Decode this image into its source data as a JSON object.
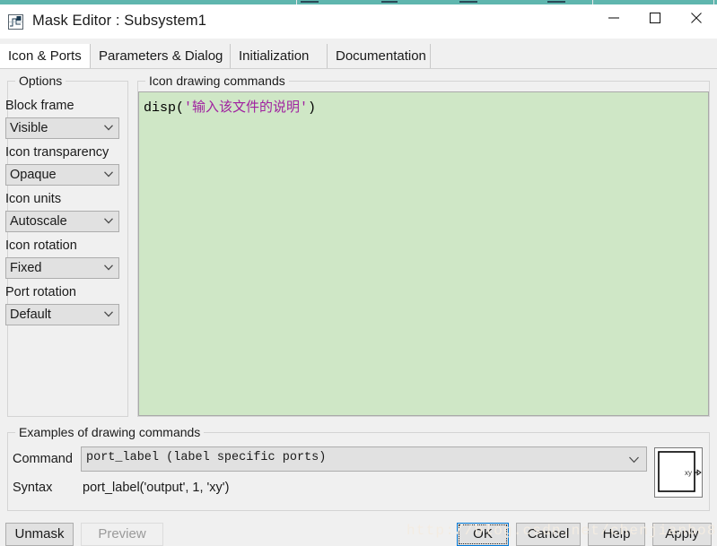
{
  "window": {
    "title": "Mask Editor : Subsystem1",
    "icon": "simulink-mask-icon",
    "controls": {
      "minimize": "minimize-icon",
      "maximize": "maximize-icon",
      "close": "close-icon"
    }
  },
  "tabs": [
    {
      "label": "Icon & Ports",
      "active": true
    },
    {
      "label": "Parameters & Dialog",
      "active": false
    },
    {
      "label": "Initialization",
      "active": false
    },
    {
      "label": "Documentation",
      "active": false
    }
  ],
  "options": {
    "group_title": "Options",
    "fields": [
      {
        "label": "Block frame",
        "value": "Visible"
      },
      {
        "label": "Icon transparency",
        "value": "Opaque"
      },
      {
        "label": "Icon units",
        "value": "Autoscale"
      },
      {
        "label": "Icon rotation",
        "value": "Fixed"
      },
      {
        "label": "Port rotation",
        "value": "Default"
      }
    ]
  },
  "icon_commands": {
    "group_title": "Icon drawing commands",
    "code_prefix": "disp(",
    "code_string": "'输入该文件的说明'",
    "code_suffix": ")"
  },
  "examples": {
    "group_title": "Examples of drawing commands",
    "command_label": "Command",
    "command_value": "port_label (label specific ports)",
    "syntax_label": "Syntax",
    "syntax_value": "port_label('output', 1, 'xy')",
    "preview_port_label": "xy"
  },
  "buttons": {
    "unmask": "Unmask",
    "preview": "Preview",
    "ok": "OK",
    "cancel": "Cancel",
    "help": "Help",
    "apply": "Apply"
  },
  "watermark": "http://blog.csdn.net/chenjianbo88",
  "colors": {
    "code_background": "#cfe7c6",
    "code_string": "#a021a0",
    "accent_focus": "#0078d7",
    "background_strip": "#5fb6ae"
  }
}
